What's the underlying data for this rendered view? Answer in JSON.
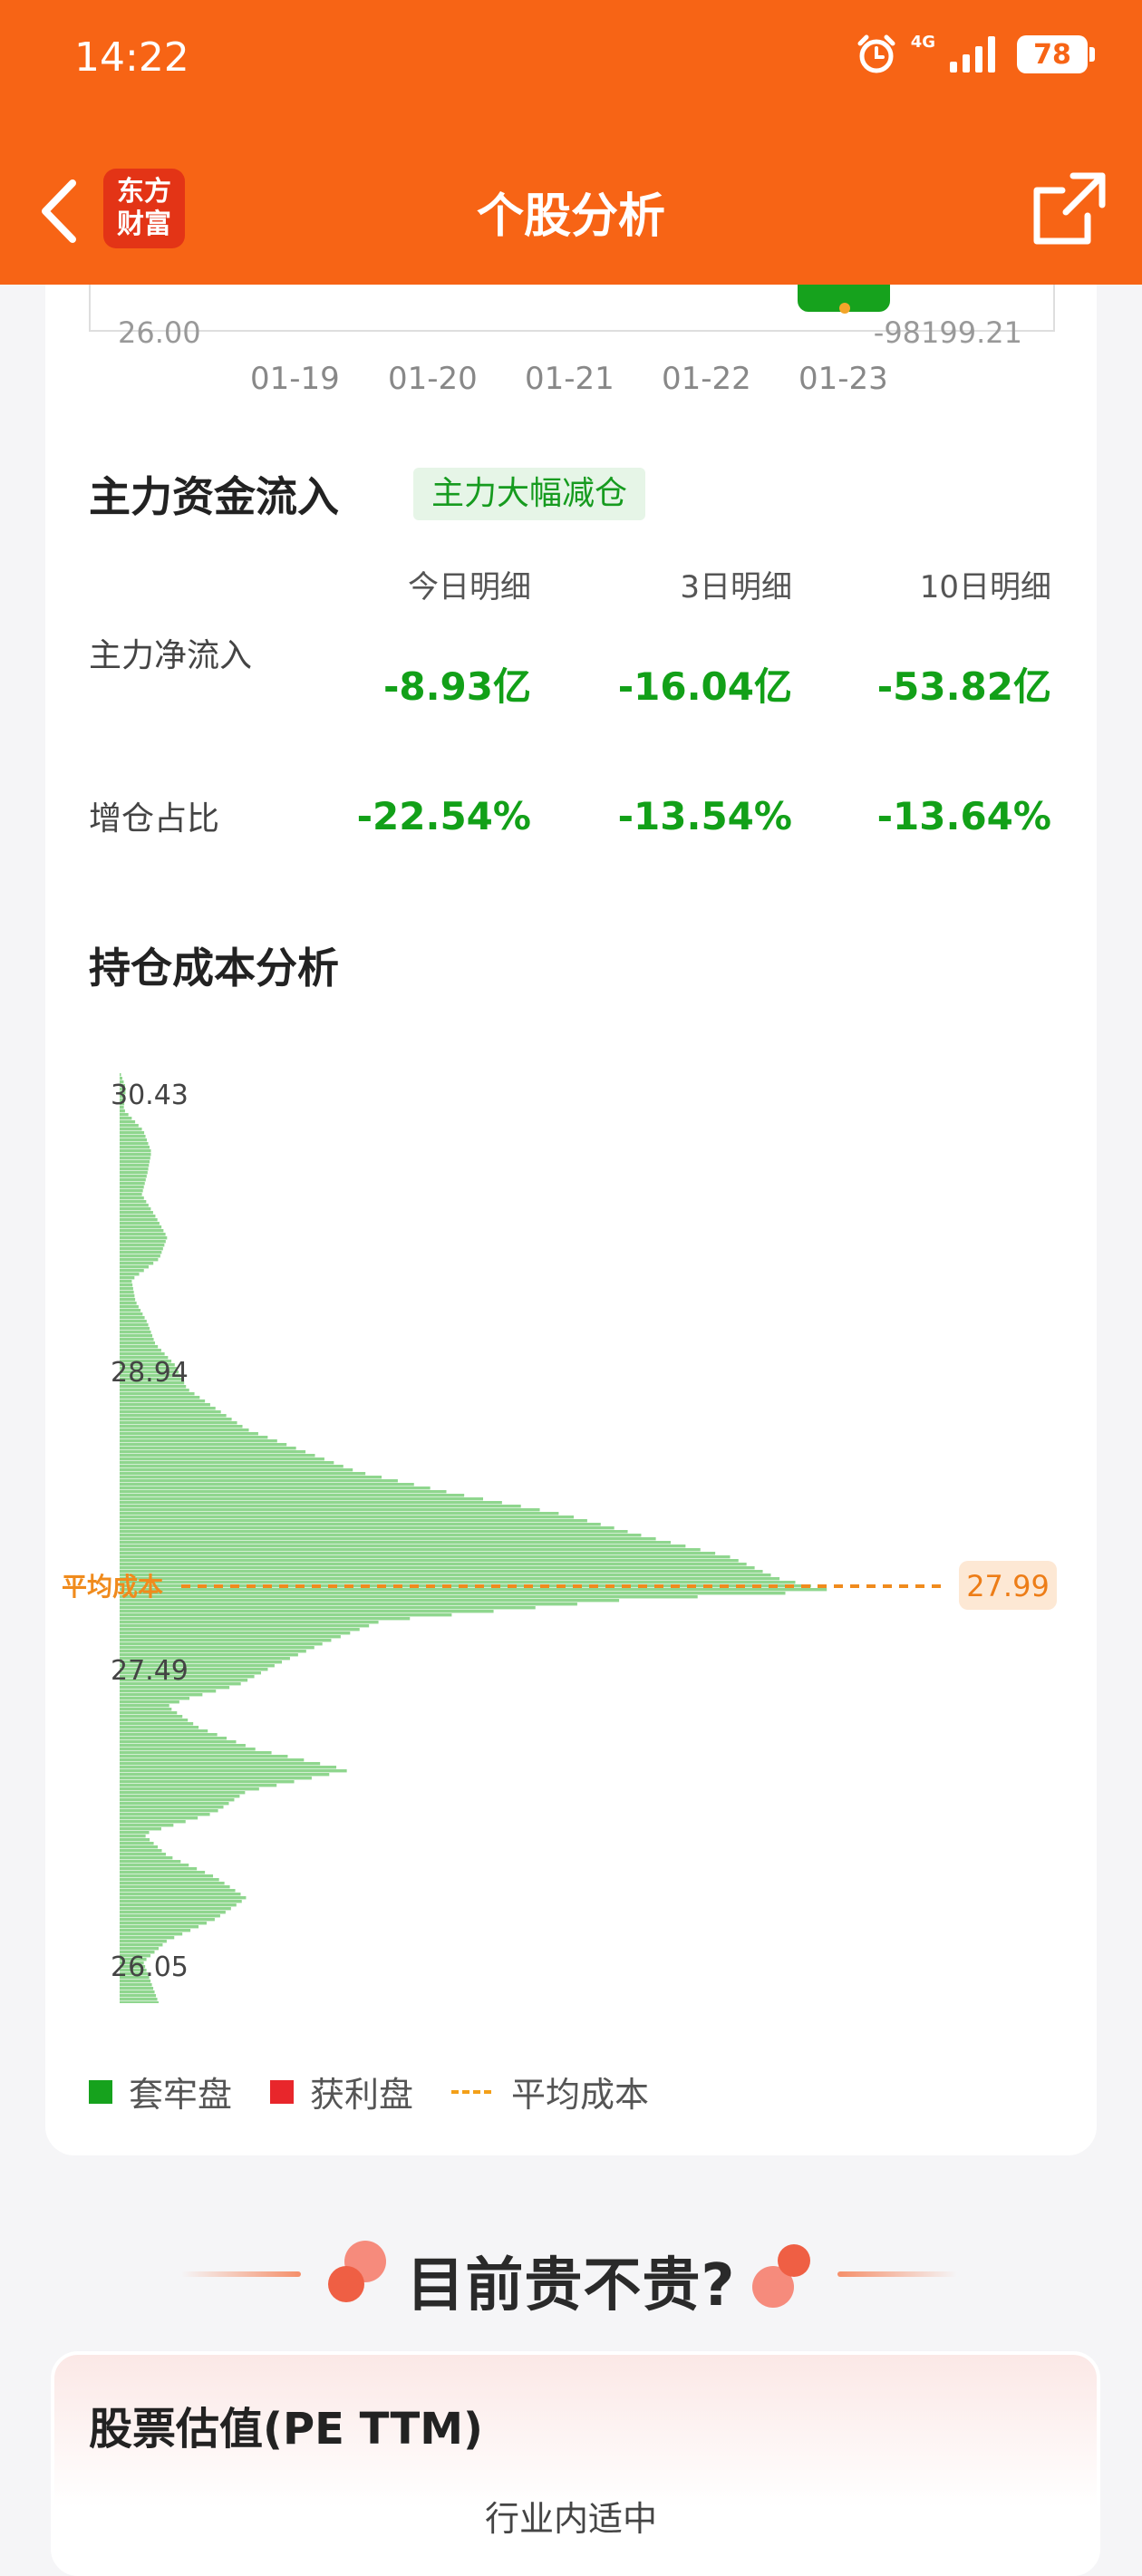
{
  "status_bar": {
    "time": "14:22",
    "network": "4G",
    "battery": "78"
  },
  "nav": {
    "logo_line1": "东方",
    "logo_line2": "财富",
    "title": "个股分析"
  },
  "mini_chart": {
    "left_value": "26.00",
    "right_value": "-98199.21",
    "dates": [
      "01-19",
      "01-20",
      "01-21",
      "01-22",
      "01-23"
    ]
  },
  "capital_flow": {
    "title": "主力资金流入",
    "tag": "主力大幅减仓",
    "columns": [
      "今日明细",
      "3日明细",
      "10日明细"
    ],
    "rows": [
      {
        "label": "主力净流入",
        "values": [
          "-8.93亿",
          "-16.04亿",
          "-53.82亿"
        ]
      },
      {
        "label": "增仓占比",
        "values": [
          "-22.54%",
          "-13.54%",
          "-13.64%"
        ]
      }
    ]
  },
  "cost_analysis": {
    "title": "持仓成本分析",
    "avg_label": "平均成本",
    "avg_value": "27.99",
    "legend": [
      "套牢盘",
      "获利盘",
      "平均成本"
    ],
    "colors": {
      "trapped": "#8fd68e",
      "trapped_legend": "#16a21d",
      "profit": "#e8262b",
      "avg": "#f3a019"
    }
  },
  "chart_data": {
    "type": "bar",
    "orientation": "horizontal",
    "y_ticks": [
      "30.43",
      "28.94",
      "27.49",
      "26.05"
    ],
    "ylim": [
      26.05,
      30.43
    ],
    "average_cost": 27.99,
    "price": [
      30.43,
      30.35,
      30.25,
      30.15,
      30.05,
      29.95,
      29.85,
      29.75,
      29.65,
      29.55,
      29.45,
      29.35,
      29.25,
      29.15,
      29.05,
      28.94,
      28.85,
      28.75,
      28.65,
      28.55,
      28.45,
      28.35,
      28.25,
      28.15,
      28.05,
      27.99,
      27.95,
      27.85,
      27.75,
      27.65,
      27.55,
      27.49,
      27.45,
      27.35,
      27.25,
      27.15,
      27.05,
      26.95,
      26.85,
      26.75,
      26.65,
      26.55,
      26.45,
      26.35,
      26.25,
      26.15,
      26.05
    ],
    "values": [
      0,
      8,
      5,
      30,
      40,
      35,
      28,
      45,
      60,
      50,
      15,
      20,
      35,
      45,
      70,
      85,
      120,
      160,
      230,
      300,
      420,
      560,
      660,
      770,
      830,
      900,
      640,
      330,
      260,
      200,
      150,
      90,
      60,
      100,
      170,
      290,
      160,
      120,
      30,
      60,
      120,
      160,
      120,
      60,
      30,
      40,
      50
    ],
    "series": [
      {
        "name": "套牢盘"
      }
    ]
  },
  "bottom": {
    "banner": "目前贵不贵?",
    "valuation_title": "股票估值(PE TTM)",
    "valuation_sub": "行业内适中"
  }
}
